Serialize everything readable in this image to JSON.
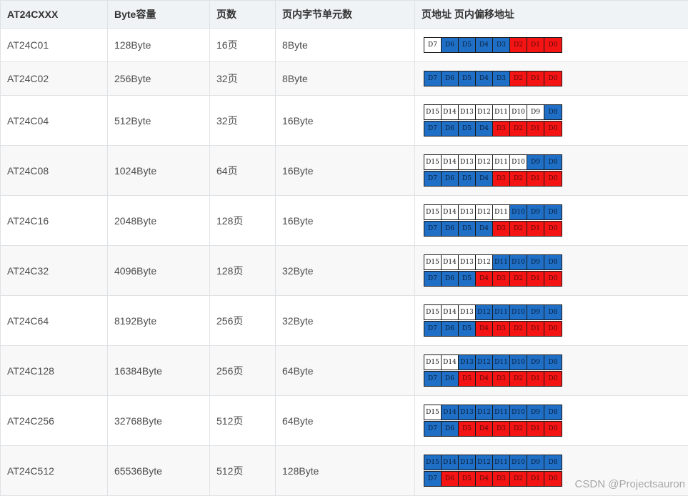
{
  "headers": [
    "AT24CXXX",
    "Byte容量",
    "页数",
    "页内字节单元数",
    "页地址 页内偏移地址"
  ],
  "colors": {
    "page_bit": "#1f6fc6",
    "offset_bit": "#f51414",
    "unused_bit": "#ffffff"
  },
  "rows": [
    {
      "model": "AT24C01",
      "capacity": "128Byte",
      "pages": "16页",
      "bytes_per_page": "8Byte",
      "regs": [
        {
          "labels": [
            "D7",
            "D6",
            "D5",
            "D4",
            "D3",
            "D2",
            "D1",
            "D0"
          ],
          "colors": [
            "w",
            "b",
            "b",
            "b",
            "b",
            "r",
            "r",
            "r"
          ]
        }
      ]
    },
    {
      "model": "AT24C02",
      "capacity": "256Byte",
      "pages": "32页",
      "bytes_per_page": "8Byte",
      "regs": [
        {
          "labels": [
            "D7",
            "D6",
            "D5",
            "D4",
            "D3",
            "D2",
            "D1",
            "D0"
          ],
          "colors": [
            "b",
            "b",
            "b",
            "b",
            "b",
            "r",
            "r",
            "r"
          ]
        }
      ]
    },
    {
      "model": "AT24C04",
      "capacity": "512Byte",
      "pages": "32页",
      "bytes_per_page": "16Byte",
      "regs": [
        {
          "labels": [
            "D15",
            "D14",
            "D13",
            "D12",
            "D11",
            "D10",
            "D9",
            "D8"
          ],
          "colors": [
            "w",
            "w",
            "w",
            "w",
            "w",
            "w",
            "w",
            "b"
          ]
        },
        {
          "labels": [
            "D7",
            "D6",
            "D5",
            "D4",
            "D3",
            "D2",
            "D1",
            "D0"
          ],
          "colors": [
            "b",
            "b",
            "b",
            "b",
            "r",
            "r",
            "r",
            "r"
          ]
        }
      ]
    },
    {
      "model": "AT24C08",
      "capacity": "1024Byte",
      "pages": "64页",
      "bytes_per_page": "16Byte",
      "regs": [
        {
          "labels": [
            "D15",
            "D14",
            "D13",
            "D12",
            "D11",
            "D10",
            "D9",
            "D8"
          ],
          "colors": [
            "w",
            "w",
            "w",
            "w",
            "w",
            "w",
            "b",
            "b"
          ]
        },
        {
          "labels": [
            "D7",
            "D6",
            "D5",
            "D4",
            "D3",
            "D2",
            "D1",
            "D0"
          ],
          "colors": [
            "b",
            "b",
            "b",
            "b",
            "r",
            "r",
            "r",
            "r"
          ]
        }
      ]
    },
    {
      "model": "AT24C16",
      "capacity": "2048Byte",
      "pages": "128页",
      "bytes_per_page": "16Byte",
      "regs": [
        {
          "labels": [
            "D15",
            "D14",
            "D13",
            "D12",
            "D11",
            "D10",
            "D9",
            "D8"
          ],
          "colors": [
            "w",
            "w",
            "w",
            "w",
            "w",
            "b",
            "b",
            "b"
          ]
        },
        {
          "labels": [
            "D7",
            "D6",
            "D5",
            "D4",
            "D3",
            "D2",
            "D1",
            "D0"
          ],
          "colors": [
            "b",
            "b",
            "b",
            "b",
            "r",
            "r",
            "r",
            "r"
          ]
        }
      ]
    },
    {
      "model": "AT24C32",
      "capacity": "4096Byte",
      "pages": "128页",
      "bytes_per_page": "32Byte",
      "regs": [
        {
          "labels": [
            "D15",
            "D14",
            "D13",
            "D12",
            "D11",
            "D10",
            "D9",
            "D8"
          ],
          "colors": [
            "w",
            "w",
            "w",
            "w",
            "b",
            "b",
            "b",
            "b"
          ]
        },
        {
          "labels": [
            "D7",
            "D6",
            "D5",
            "D4",
            "D3",
            "D2",
            "D1",
            "D0"
          ],
          "colors": [
            "b",
            "b",
            "b",
            "r",
            "r",
            "r",
            "r",
            "r"
          ]
        }
      ]
    },
    {
      "model": "AT24C64",
      "capacity": "8192Byte",
      "pages": "256页",
      "bytes_per_page": "32Byte",
      "regs": [
        {
          "labels": [
            "D15",
            "D14",
            "D13",
            "D12",
            "D11",
            "D10",
            "D9",
            "D8"
          ],
          "colors": [
            "w",
            "w",
            "w",
            "b",
            "b",
            "b",
            "b",
            "b"
          ]
        },
        {
          "labels": [
            "D7",
            "D6",
            "D5",
            "D4",
            "D3",
            "D2",
            "D1",
            "D0"
          ],
          "colors": [
            "b",
            "b",
            "b",
            "r",
            "r",
            "r",
            "r",
            "r"
          ]
        }
      ]
    },
    {
      "model": "AT24C128",
      "capacity": "16384Byte",
      "pages": "256页",
      "bytes_per_page": "64Byte",
      "regs": [
        {
          "labels": [
            "D15",
            "D14",
            "D13",
            "D12",
            "D11",
            "D10",
            "D9",
            "D8"
          ],
          "colors": [
            "w",
            "w",
            "b",
            "b",
            "b",
            "b",
            "b",
            "b"
          ]
        },
        {
          "labels": [
            "D7",
            "D6",
            "D5",
            "D4",
            "D3",
            "D2",
            "D1",
            "D0"
          ],
          "colors": [
            "b",
            "b",
            "r",
            "r",
            "r",
            "r",
            "r",
            "r"
          ]
        }
      ]
    },
    {
      "model": "AT24C256",
      "capacity": "32768Byte",
      "pages": "512页",
      "bytes_per_page": "64Byte",
      "regs": [
        {
          "labels": [
            "D15",
            "D14",
            "D13",
            "D12",
            "D11",
            "D10",
            "D9",
            "D8"
          ],
          "colors": [
            "w",
            "b",
            "b",
            "b",
            "b",
            "b",
            "b",
            "b"
          ]
        },
        {
          "labels": [
            "D7",
            "D6",
            "D5",
            "D4",
            "D3",
            "D2",
            "D1",
            "D0"
          ],
          "colors": [
            "b",
            "b",
            "r",
            "r",
            "r",
            "r",
            "r",
            "r"
          ]
        }
      ]
    },
    {
      "model": "AT24C512",
      "capacity": "65536Byte",
      "pages": "512页",
      "bytes_per_page": "128Byte",
      "regs": [
        {
          "labels": [
            "D15",
            "D14",
            "D13",
            "D12",
            "D11",
            "D10",
            "D9",
            "D8"
          ],
          "colors": [
            "b",
            "b",
            "b",
            "b",
            "b",
            "b",
            "b",
            "b"
          ]
        },
        {
          "labels": [
            "D7",
            "D6",
            "D5",
            "D4",
            "D3",
            "D2",
            "D1",
            "D0"
          ],
          "colors": [
            "b",
            "r",
            "r",
            "r",
            "r",
            "r",
            "r",
            "r"
          ]
        }
      ]
    }
  ],
  "watermark": "CSDN @Projectsauron"
}
